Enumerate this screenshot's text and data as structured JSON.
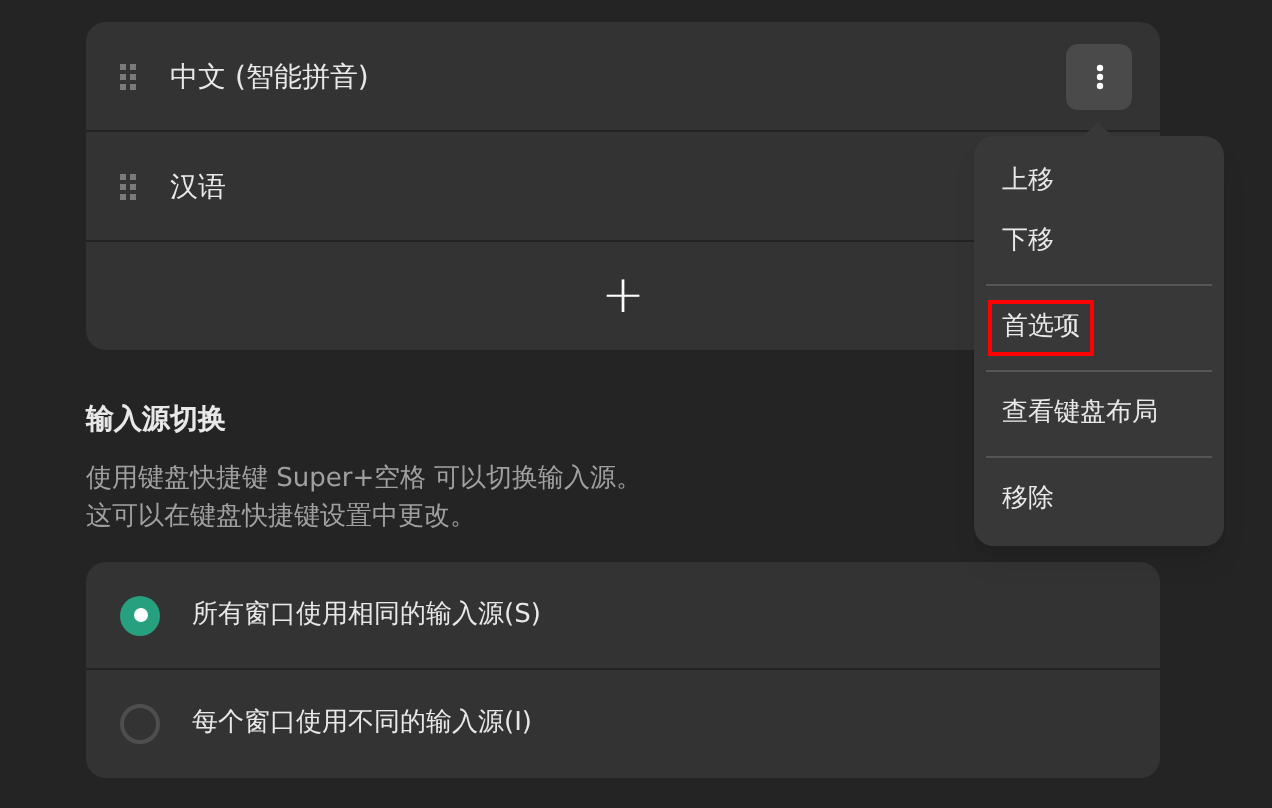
{
  "input_sources": [
    {
      "name": "中文 (智能拼音)",
      "menu_open": true
    },
    {
      "name": "汉语"
    }
  ],
  "add_button": {
    "label": "+"
  },
  "row_menu": {
    "items": [
      {
        "label": "上移",
        "outlined": false,
        "separator_before": false
      },
      {
        "label": "下移",
        "outlined": false,
        "separator_before": false
      },
      {
        "label": "首选项",
        "outlined": true,
        "separator_before": true
      },
      {
        "label": "查看键盘布局",
        "outlined": false,
        "separator_before": true
      },
      {
        "label": "移除",
        "outlined": false,
        "separator_before": true
      }
    ]
  },
  "switching": {
    "title": "输入源切换",
    "description": [
      "使用键盘快捷键 Super+空格 可以切换输入源。",
      "这可以在键盘快捷键设置中更改。"
    ],
    "options": [
      {
        "label": "所有窗口使用相同的输入源(S)",
        "selected": true
      },
      {
        "label": "每个窗口使用不同的输入源(I)",
        "selected": false
      }
    ]
  }
}
